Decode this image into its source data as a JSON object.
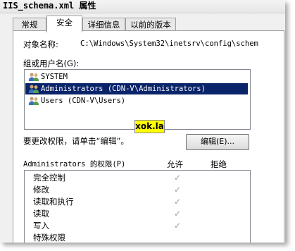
{
  "window": {
    "title": "IIS_schema.xml 属性"
  },
  "tabs": [
    {
      "label": "常规"
    },
    {
      "label": "安全"
    },
    {
      "label": "详细信息"
    },
    {
      "label": "以前的版本"
    }
  ],
  "security": {
    "object_name_label": "对象名称:",
    "object_name_value": "C:\\Windows\\System32\\inetsrv\\config\\schem",
    "groups_label": "组或用户名(G):",
    "groups": [
      {
        "name": "SYSTEM",
        "icon": "users-icon",
        "selected": false
      },
      {
        "name": "Administrators (CDN-V\\Administrators)",
        "icon": "users-icon",
        "selected": true
      },
      {
        "name": "Users (CDN-V\\Users)",
        "icon": "users-icon",
        "selected": false
      }
    ],
    "change_hint": "要更改权限，请单击“编辑”。",
    "edit_button_label": "编辑(E)...",
    "permissions_header": "Administrators 的权限(P)",
    "allow_label": "允许",
    "deny_label": "拒绝",
    "permissions": [
      {
        "name": "完全控制",
        "allow": true,
        "deny": false
      },
      {
        "name": "修改",
        "allow": true,
        "deny": false
      },
      {
        "name": "读取和执行",
        "allow": true,
        "deny": false
      },
      {
        "name": "读取",
        "allow": true,
        "deny": false
      },
      {
        "name": "写入",
        "allow": true,
        "deny": false
      },
      {
        "name": "特殊权限",
        "allow": false,
        "deny": false
      }
    ]
  },
  "watermark": {
    "text": "xok.la"
  },
  "colors": {
    "selection": "#0a246a",
    "watermark_bg": "#ffff00",
    "check": "#a0a0a0"
  }
}
